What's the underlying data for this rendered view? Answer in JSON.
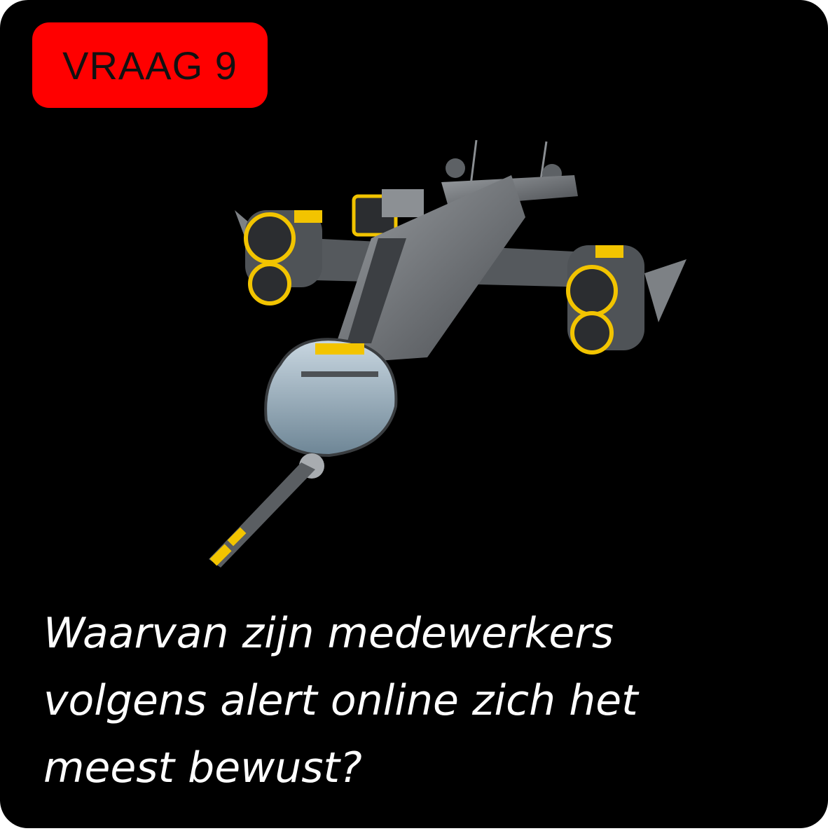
{
  "badge": {
    "label": "VRAAG 9",
    "color": "#ff0000"
  },
  "illustration": {
    "subject": "spaceship",
    "colors": {
      "body": "#6b6f73",
      "accent": "#f2c400",
      "glass": "#9fb4c4"
    }
  },
  "question": {
    "text": "Waarvan zijn medewerkers\nvolgens alert online zich het\nmeest bewust?"
  },
  "colors": {
    "background": "#000000",
    "text": "#ffffff"
  }
}
